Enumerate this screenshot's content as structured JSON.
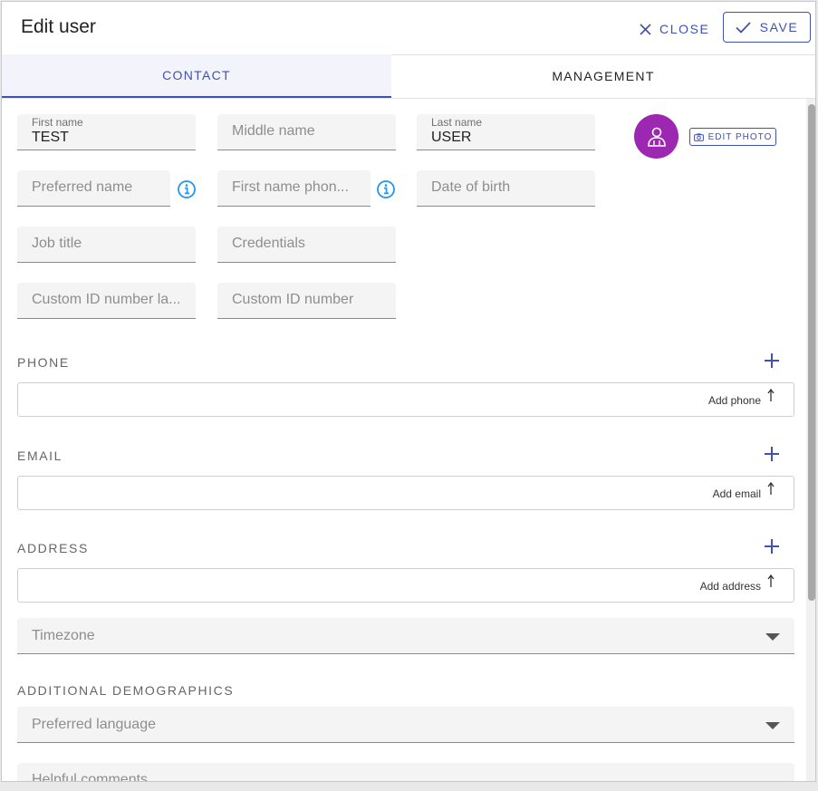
{
  "header": {
    "title": "Edit user",
    "close_label": "CLOSE",
    "save_label": "SAVE"
  },
  "tabs": [
    {
      "label": "CONTACT",
      "active": true
    },
    {
      "label": "MANAGEMENT",
      "active": false
    }
  ],
  "fields": {
    "first_name": {
      "label": "First name",
      "value": "TEST"
    },
    "middle_name": {
      "placeholder": "Middle name"
    },
    "last_name": {
      "label": "Last name",
      "value": "USER"
    },
    "preferred_name": {
      "placeholder": "Preferred name"
    },
    "first_name_phonetic": {
      "placeholder": "First name phon..."
    },
    "date_of_birth": {
      "placeholder": "Date of birth"
    },
    "job_title": {
      "placeholder": "Job title"
    },
    "credentials": {
      "placeholder": "Credentials"
    },
    "custom_id_label": {
      "placeholder": "Custom ID number la..."
    },
    "custom_id_number": {
      "placeholder": "Custom ID number"
    }
  },
  "photo": {
    "edit_label": "EDIT PHOTO",
    "avatar_color": "#9c27b0"
  },
  "sections": {
    "phone": {
      "title": "PHONE",
      "add_label": "Add phone"
    },
    "email": {
      "title": "EMAIL",
      "add_label": "Add email"
    },
    "address": {
      "title": "ADDRESS",
      "add_label": "Add address"
    }
  },
  "timezone": {
    "placeholder": "Timezone"
  },
  "demographics": {
    "title": "ADDITIONAL DEMOGRAPHICS",
    "language_placeholder": "Preferred language",
    "comments_placeholder": "Helpful comments"
  },
  "colors": {
    "accent": "#3f51b5",
    "info": "#2196f3"
  }
}
